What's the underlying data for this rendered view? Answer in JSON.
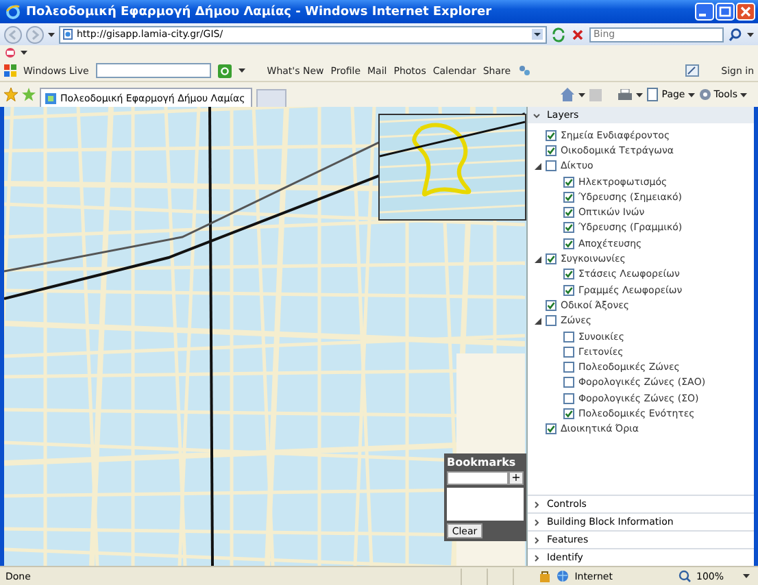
{
  "window": {
    "title": "Πολεοδομική Εφαρμογή Δήμου Λαμίας - Windows Internet Explorer"
  },
  "address_bar": {
    "url": "http://gisapp.lamia-city.gr/GIS/"
  },
  "search": {
    "placeholder": "Bing"
  },
  "live_toolbar": {
    "brand": "Windows Live",
    "links": [
      "What's New",
      "Profile",
      "Mail",
      "Photos",
      "Calendar",
      "Share"
    ],
    "sign_in": "Sign in"
  },
  "tabs": [
    {
      "title": "Πολεοδομική Εφαρμογή Δήμου Λαμίας",
      "selected": true
    }
  ],
  "command_bar": {
    "menus": [
      "Page",
      "Tools"
    ]
  },
  "bookmarks": {
    "title": "Bookmarks",
    "add": "+",
    "clear": "Clear"
  },
  "panel": {
    "sections": [
      {
        "title": "Layers",
        "expanded": true,
        "layers": [
          {
            "label": "Σημεία Ενδιαφέροντος",
            "checked": true
          },
          {
            "label": "Οικοδομικά Τετράγωνα",
            "checked": true
          },
          {
            "label": "Δίκτυο",
            "checked": false,
            "expanded": true,
            "children": [
              {
                "label": "Ηλεκτροφωτισμός",
                "checked": true
              },
              {
                "label": "Ύδρευσης (Σημειακό)",
                "checked": true
              },
              {
                "label": "Οπτικών Ινών",
                "checked": true
              },
              {
                "label": "Ύδρευσης (Γραμμικό)",
                "checked": true
              },
              {
                "label": "Αποχέτευσης",
                "checked": true
              }
            ]
          },
          {
            "label": "Συγκοινωνίες",
            "checked": true,
            "expanded": true,
            "children": [
              {
                "label": "Στάσεις Λεωφορείων",
                "checked": true
              },
              {
                "label": "Γραμμές Λεωφορείων",
                "checked": true
              }
            ]
          },
          {
            "label": "Οδικοί Άξονες",
            "checked": true
          },
          {
            "label": "Ζώνες",
            "checked": false,
            "expanded": true,
            "children": [
              {
                "label": "Συνοικίες",
                "checked": false
              },
              {
                "label": "Γειτονίες",
                "checked": false
              },
              {
                "label": "Πολεοδομικές Ζώνες",
                "checked": false
              },
              {
                "label": "Φορολογικές Ζώνες (ΣΑΟ)",
                "checked": false
              },
              {
                "label": "Φορολογικές Ζώνες (ΣΟ)",
                "checked": false
              },
              {
                "label": "Πολεοδομικές Ενότητες",
                "checked": true
              }
            ]
          },
          {
            "label": "Διοικητικά Όρια",
            "checked": true
          }
        ]
      },
      {
        "title": "Controls",
        "expanded": false
      },
      {
        "title": "Building Block Information",
        "expanded": false
      },
      {
        "title": "Features",
        "expanded": false
      },
      {
        "title": "Identify",
        "expanded": false
      }
    ]
  },
  "status_bar": {
    "text": "Done",
    "zone": "Internet",
    "zoom": "100%"
  }
}
